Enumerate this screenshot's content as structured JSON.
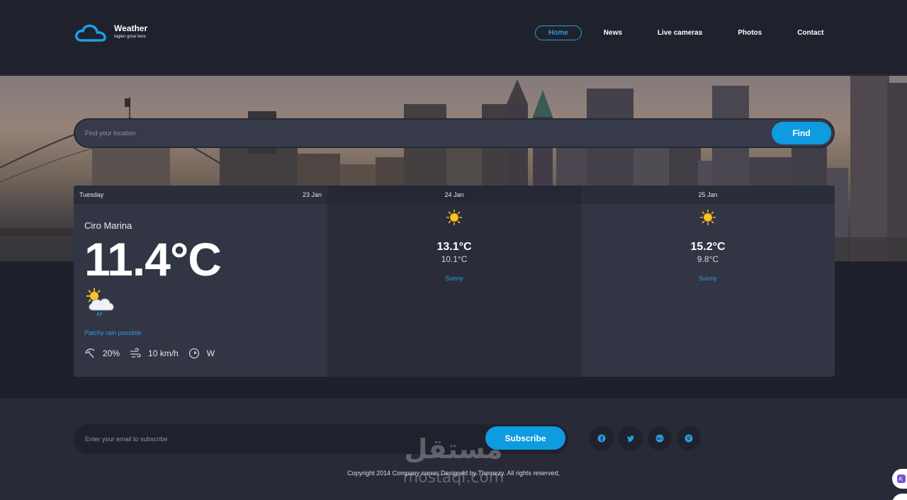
{
  "header": {
    "logo_title": "Weather",
    "logo_tagline": "taglen gose here",
    "nav": [
      {
        "label": "Home",
        "active": true
      },
      {
        "label": "News",
        "active": false
      },
      {
        "label": "Live cameras",
        "active": false
      },
      {
        "label": "Photos",
        "active": false
      },
      {
        "label": "Contact",
        "active": false
      }
    ]
  },
  "search": {
    "placeholder": "Find your location",
    "button_label": "Find"
  },
  "forecast": {
    "today": {
      "day": "Tuesday",
      "date": "23 Jan",
      "location": "Ciro Marina",
      "temperature": "11.4°C",
      "condition": "Patchy rain possible",
      "condition_icon": "cloud-sun-rain-icon",
      "precipitation": "20%",
      "wind_speed": "10 km/h",
      "wind_direction": "W"
    },
    "days": [
      {
        "date": "24 Jan",
        "max": "13.1°C",
        "min": "10.1°C",
        "condition": "Sunny",
        "icon": "sun-icon"
      },
      {
        "date": "25 Jan",
        "max": "15.2°C",
        "min": "9.8°C",
        "condition": "Sunny",
        "icon": "sun-icon"
      }
    ]
  },
  "footer": {
    "subscribe_placeholder": "Enter your email to subscribe",
    "subscribe_button": "Subscribe",
    "social": [
      "facebook-icon",
      "twitter-icon",
      "google-plus-icon",
      "pinterest-icon"
    ],
    "copyright": "Copyright 2014 Company name, Designed by Themezy. All rights reserved,"
  },
  "watermark": {
    "arabic": "مستقل",
    "latin": "mostaql.com"
  },
  "colors": {
    "accent": "#0f9be0",
    "background": "#1e202b",
    "panel": "#323543"
  }
}
